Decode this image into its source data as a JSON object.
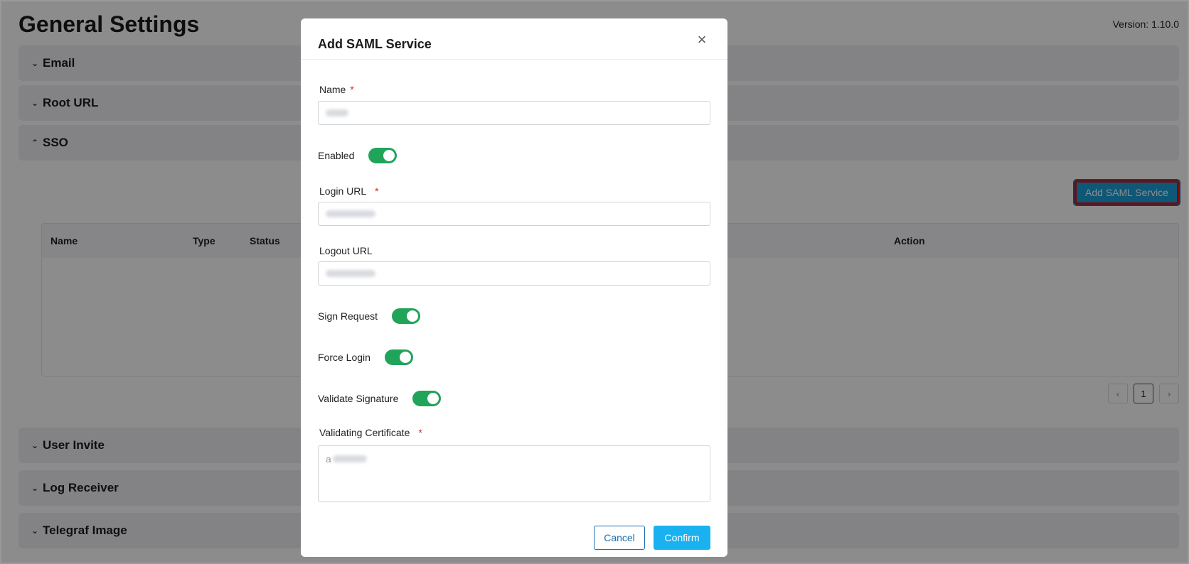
{
  "page": {
    "title": "General Settings",
    "version": "Version: 1.10.0"
  },
  "panels": [
    {
      "label": "Email",
      "chevron": "⌄"
    },
    {
      "label": "Root URL",
      "chevron": "⌄"
    },
    {
      "label": "SSO",
      "chevron": "⌃"
    },
    {
      "label": "User Invite",
      "chevron": "⌄"
    },
    {
      "label": "Log Receiver",
      "chevron": "⌄"
    },
    {
      "label": "Telegraf Image",
      "chevron": "⌄"
    }
  ],
  "sso": {
    "add_button": "Add SAML Service",
    "table_headers": {
      "name": "Name",
      "type": "Type",
      "status": "Status",
      "action": "Action"
    },
    "pager": {
      "prev": "‹",
      "page": "1",
      "next": "›"
    }
  },
  "modal": {
    "title": "Add SAML Service",
    "close_glyph": "×",
    "fields": {
      "name_label": "Name",
      "login_url_label": "Login URL",
      "logout_url_label": "Logout URL",
      "validating_certificate_label": "Validating Certificate",
      "required_mark": "*",
      "cert_prefix": "a"
    },
    "toggles": {
      "enabled": "Enabled",
      "sign_request": "Sign Request",
      "force_login": "Force Login",
      "validate_signature": "Validate Signature"
    },
    "buttons": {
      "cancel": "Cancel",
      "confirm": "Confirm"
    }
  },
  "colors": {
    "toggle_on": "#20a45a",
    "primary": "#1ab1f0",
    "required": "#e02424"
  }
}
